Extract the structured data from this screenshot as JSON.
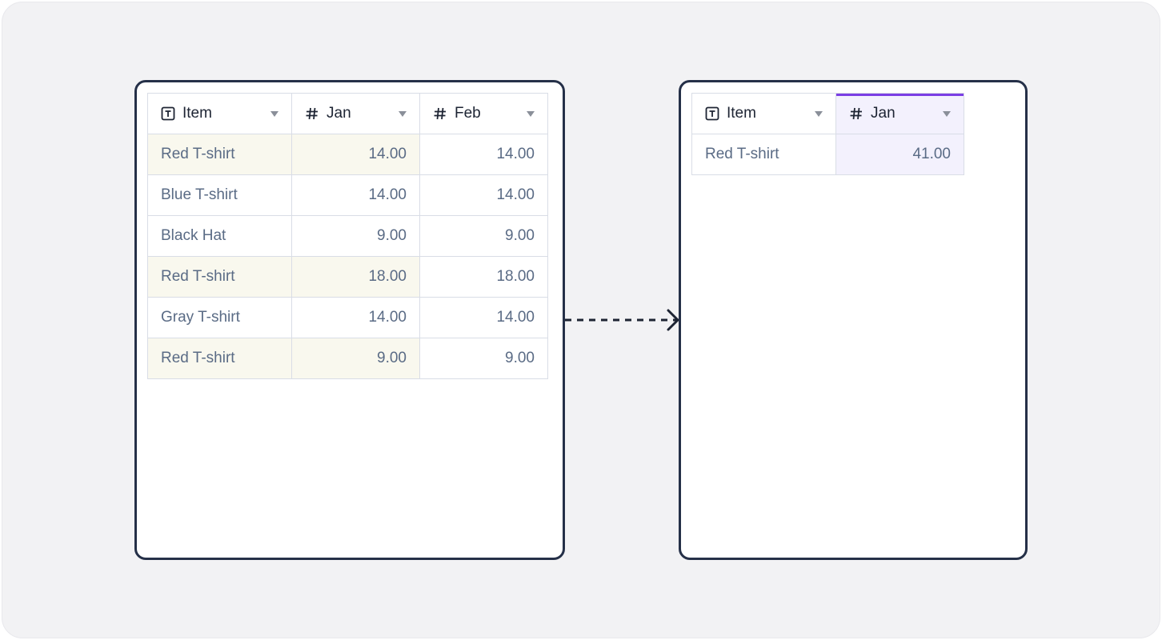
{
  "source_table": {
    "columns": [
      {
        "label": "Item",
        "icon": "text-field-icon"
      },
      {
        "label": "Jan",
        "icon": "hash-icon"
      },
      {
        "label": "Feb",
        "icon": "hash-icon"
      }
    ],
    "rows": [
      {
        "item": "Red T-shirt",
        "jan": "14.00",
        "feb": "14.00",
        "highlighted": true
      },
      {
        "item": "Blue T-shirt",
        "jan": "14.00",
        "feb": "14.00",
        "highlighted": false
      },
      {
        "item": "Black Hat",
        "jan": "9.00",
        "feb": "9.00",
        "highlighted": false
      },
      {
        "item": "Red T-shirt",
        "jan": "18.00",
        "feb": "18.00",
        "highlighted": true
      },
      {
        "item": "Gray T-shirt",
        "jan": "14.00",
        "feb": "14.00",
        "highlighted": false
      },
      {
        "item": "Red T-shirt",
        "jan": "9.00",
        "feb": "9.00",
        "highlighted": true
      }
    ],
    "highlight_color": "#f9f8ee"
  },
  "result_table": {
    "columns": [
      {
        "label": "Item",
        "icon": "text-field-icon"
      },
      {
        "label": "Jan",
        "icon": "hash-icon"
      }
    ],
    "rows": [
      {
        "item": "Red T-shirt",
        "jan": "41.00"
      }
    ],
    "accent_color": "#7b3fe4",
    "highlight_color": "#f3f1fd"
  },
  "connector": {
    "style": "dashed-arrow",
    "color": "#1d2433"
  }
}
